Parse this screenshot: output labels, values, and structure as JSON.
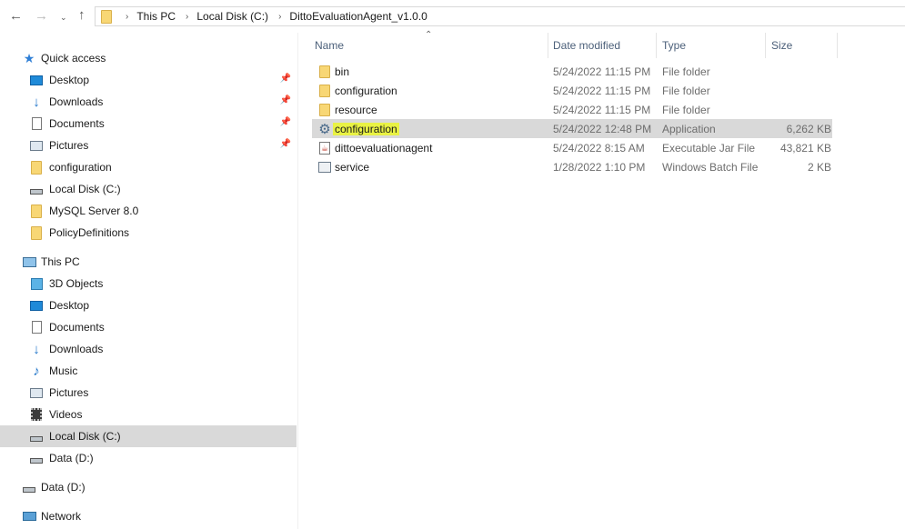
{
  "toolbar": {
    "back_icon": "arrow-left-icon",
    "forward_icon": "arrow-right-icon",
    "recent_icon": "chevron-down-icon",
    "up_icon": "arrow-up-icon"
  },
  "address": {
    "crumbs": [
      "This PC",
      "Local Disk (C:)",
      "DittoEvaluationAgent_v1.0.0"
    ]
  },
  "nav": {
    "quick_access": "Quick access",
    "quick_items": [
      {
        "label": "Desktop",
        "icon": "desktop-icon",
        "pinned": true
      },
      {
        "label": "Downloads",
        "icon": "download-icon",
        "pinned": true
      },
      {
        "label": "Documents",
        "icon": "documents-icon",
        "pinned": true
      },
      {
        "label": "Pictures",
        "icon": "pictures-icon",
        "pinned": true
      },
      {
        "label": "configuration",
        "icon": "folder-icon",
        "pinned": false
      },
      {
        "label": "Local Disk (C:)",
        "icon": "drive-icon",
        "pinned": false
      },
      {
        "label": "MySQL Server 8.0",
        "icon": "folder-icon",
        "pinned": false
      },
      {
        "label": "PolicyDefinitions",
        "icon": "folder-icon",
        "pinned": false
      }
    ],
    "this_pc": "This PC",
    "pc_items": [
      {
        "label": "3D Objects",
        "icon": "cube-icon"
      },
      {
        "label": "Desktop",
        "icon": "desktop-icon"
      },
      {
        "label": "Documents",
        "icon": "documents-icon"
      },
      {
        "label": "Downloads",
        "icon": "download-icon"
      },
      {
        "label": "Music",
        "icon": "music-icon"
      },
      {
        "label": "Pictures",
        "icon": "pictures-icon"
      },
      {
        "label": "Videos",
        "icon": "film-icon"
      },
      {
        "label": "Local Disk (C:)",
        "icon": "drive-icon",
        "selected": true
      },
      {
        "label": "Data (D:)",
        "icon": "drive-icon"
      }
    ],
    "data_drive": "Data (D:)",
    "network": "Network"
  },
  "columns": {
    "name": "Name",
    "date": "Date modified",
    "type": "Type",
    "size": "Size"
  },
  "files": [
    {
      "name": "bin",
      "date": "5/24/2022 11:15 PM",
      "type": "File folder",
      "size": "",
      "icon": "folder-icon"
    },
    {
      "name": "configuration",
      "date": "5/24/2022 11:15 PM",
      "type": "File folder",
      "size": "",
      "icon": "folder-icon"
    },
    {
      "name": "resource",
      "date": "5/24/2022 11:15 PM",
      "type": "File folder",
      "size": "",
      "icon": "folder-icon"
    },
    {
      "name": "configuration",
      "date": "5/24/2022 12:48 PM",
      "type": "Application",
      "size": "6,262 KB",
      "icon": "gear-icon",
      "selected": true
    },
    {
      "name": "dittoevaluationagent",
      "date": "5/24/2022 8:15 AM",
      "type": "Executable Jar File",
      "size": "43,821 KB",
      "icon": "java-icon"
    },
    {
      "name": "service",
      "date": "1/28/2022 1:10 PM",
      "type": "Windows Batch File",
      "size": "2 KB",
      "icon": "batch-file-icon"
    }
  ],
  "colors": {
    "selection": "#d9d9d9",
    "highlight": "#e9f244",
    "header_text": "#4c607a"
  }
}
